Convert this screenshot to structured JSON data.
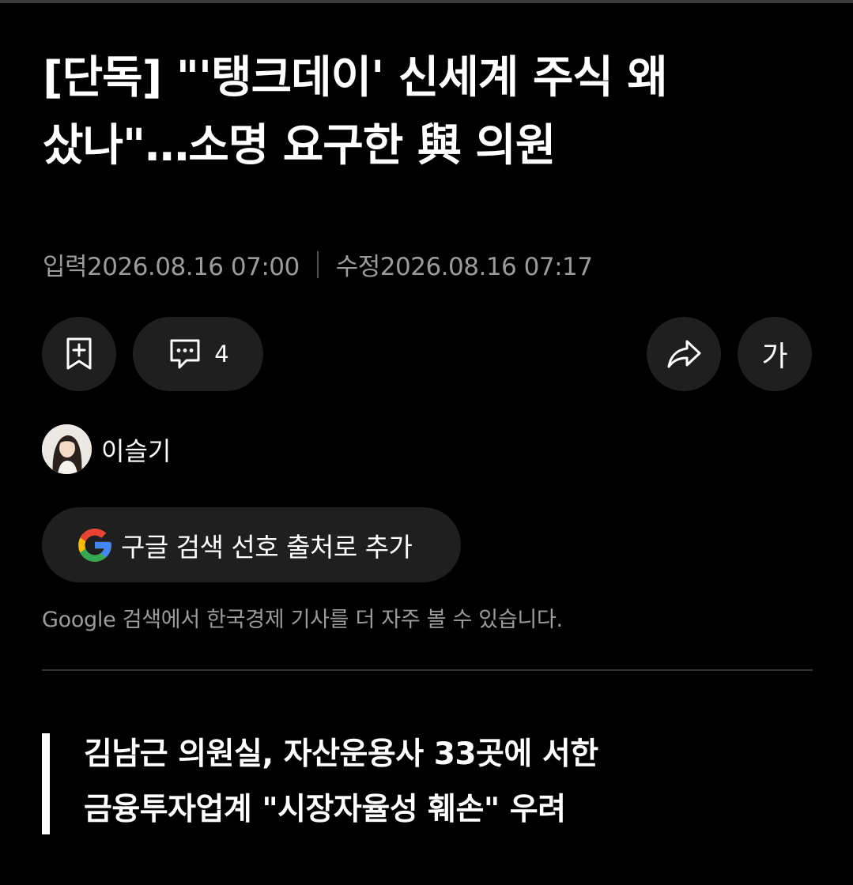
{
  "article": {
    "headline_lines": [
      "[단독] \"'탱크데이' 신세계 주식 왜",
      "샀나\"…소명 요구한 與 의원"
    ],
    "input_label": "입력2026.08.16 07:00",
    "modified_label": "수정2026.08.16 07:17",
    "subhead_lines": [
      "김남근 의원실, 자산운용사 33곳에 서한",
      "금융투자업계 \"시장자율성 훼손\" 우려"
    ]
  },
  "toolbar": {
    "bookmark_icon": "bookmark-add-icon",
    "comment_icon": "comment-icon",
    "comment_count": "4",
    "share_icon": "share-icon",
    "font_size_label": "가"
  },
  "author": {
    "name": "이슬기",
    "avatar_icon": "author-avatar"
  },
  "google": {
    "button_label": "구글 검색 선호 출처로 추가",
    "note": "Google 검색에서 한국경제 기사를 더 자주 볼 수 있습니다.",
    "logo_colors": [
      "#4285F4",
      "#EA4335",
      "#FBBC05",
      "#34A853"
    ]
  },
  "colors": {
    "background": "#000000",
    "button_bg": "#1f1f1f",
    "muted_text": "#9b9b9b"
  }
}
